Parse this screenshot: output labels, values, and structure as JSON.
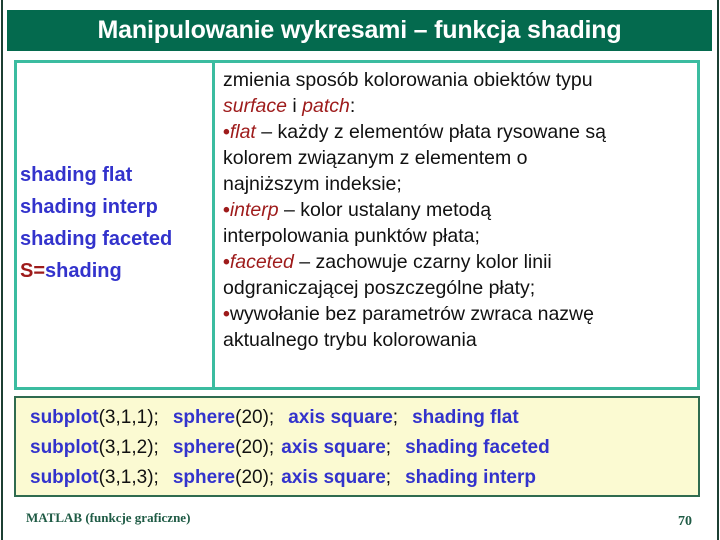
{
  "slide": {
    "title": "Manipulowanie wykresami – funkcja shading",
    "title_bg": "#046A4E",
    "accent_border": "#3BBCA0",
    "code_bg": "#FBFAD2",
    "code_border": "#2F6B4F",
    "keyword_color": "#3333CC",
    "emphasis_color": "#9E1B1B",
    "footer_color": "#1F5B45"
  },
  "commands": {
    "items": [
      {
        "text": "shading flat",
        "prefix": ""
      },
      {
        "text": "shading interp",
        "prefix": ""
      },
      {
        "text": "shading faceted",
        "prefix": ""
      },
      {
        "text": "shading",
        "prefix": "S="
      }
    ],
    "line1": "shading flat",
    "line2": "shading interp",
    "line3": "shading faceted",
    "line4_prefix": "S=",
    "line4_rest": "shading"
  },
  "description": {
    "l1": "zmienia sposób kolorowania obiektów typu",
    "l2_a": "surface",
    "l2_b": " i ",
    "l2_c": "patch",
    "l2_d": ":",
    "l3_bullet": "•",
    "l3_em": "flat",
    "l3_rest": " – każdy z elementów płata rysowane są",
    "l4": "kolorem związanym z elementem o",
    "l5": "najniższym indeksie;",
    "l6_bullet": "•",
    "l6_em": "interp",
    "l6_rest": " – kolor ustalany metodą",
    "l7": "interpolowania punktów płata;",
    "l8_bullet": "•",
    "l8_em": "faceted",
    "l8_rest": " – zachowuje czarny kolor linii",
    "l9": "odgraniczającej poszczególne płaty;",
    "l10_bullet": "•",
    "l10_rest": "wywołanie bez parametrów zwraca nazwę",
    "l11": "aktualnego trybu kolorowania"
  },
  "code": {
    "rows": [
      {
        "k1": "subplot",
        "a1": "(3,1,1);",
        "k2": "sphere",
        "a2": "(20);",
        "k3": "axis square",
        "a3": ";",
        "k4": "shading flat"
      },
      {
        "k1": "subplot",
        "a1": "(3,1,2);",
        "k2": "sphere",
        "a2": "(20);",
        "k3": "axis square",
        "a3": ";",
        "k4": "shading faceted"
      },
      {
        "k1": "subplot",
        "a1": "(3,1,3);",
        "k2": "sphere",
        "a2": "(20);",
        "k3": "axis square",
        "a3": ";",
        "k4": "shading interp"
      }
    ],
    "r0k1": "subplot",
    "r0a1": "(3,1,1);",
    "r0k2": "sphere",
    "r0a2": "(20);",
    "r0k3": "axis square",
    "r0a3": ";",
    "r0k4": "shading flat",
    "r1k1": "subplot",
    "r1a1": "(3,1,2);",
    "r1k2": "sphere",
    "r1a2": "(20);",
    "r1k3": "axis square",
    "r1a3": ";",
    "r1k4": "shading faceted",
    "r2k1": "subplot",
    "r2a1": "(3,1,3);",
    "r2k2": "sphere",
    "r2a2": "(20);",
    "r2k3": "axis square",
    "r2a3": ";",
    "r2k4": "shading interp"
  },
  "footer": {
    "note": "MATLAB (funkcje graficzne)",
    "page": "70"
  }
}
